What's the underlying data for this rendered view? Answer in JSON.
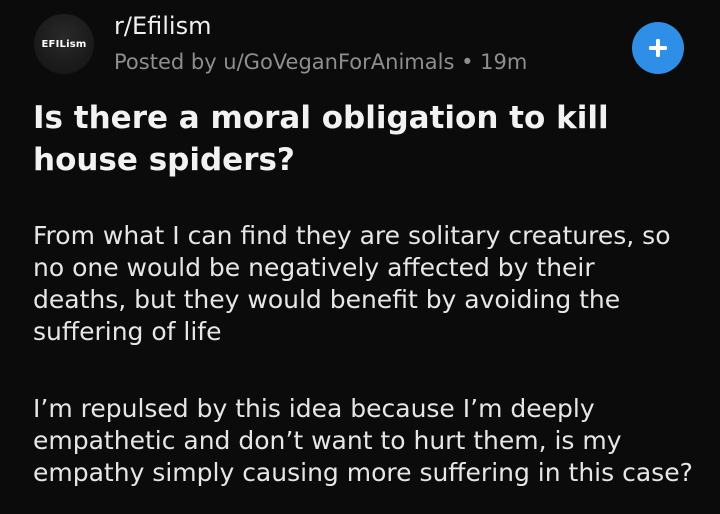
{
  "post": {
    "subreddit": "r/Efilism",
    "avatar_text": "EFILism",
    "posted_by": "Posted by u/GoVeganForAnimals",
    "separator": "•",
    "age": "19m",
    "title": "Is there a moral obligation to kill house spiders?",
    "paragraphs": [
      "From what I can find they are solitary creatures, so no one would be negatively affected by their deaths, but they would benefit by avoiding the suffering of life",
      "I’m repulsed by this idea because I’m deeply empathetic and don’t want to hurt them, is my empathy simply causing more suffering in this case?"
    ]
  },
  "icons": {
    "join": "plus-icon"
  },
  "colors": {
    "background": "#0b0b0b",
    "accent": "#2f8fe6",
    "meta_text": "#8e8e8e",
    "primary_text": "#f0f0f0"
  }
}
